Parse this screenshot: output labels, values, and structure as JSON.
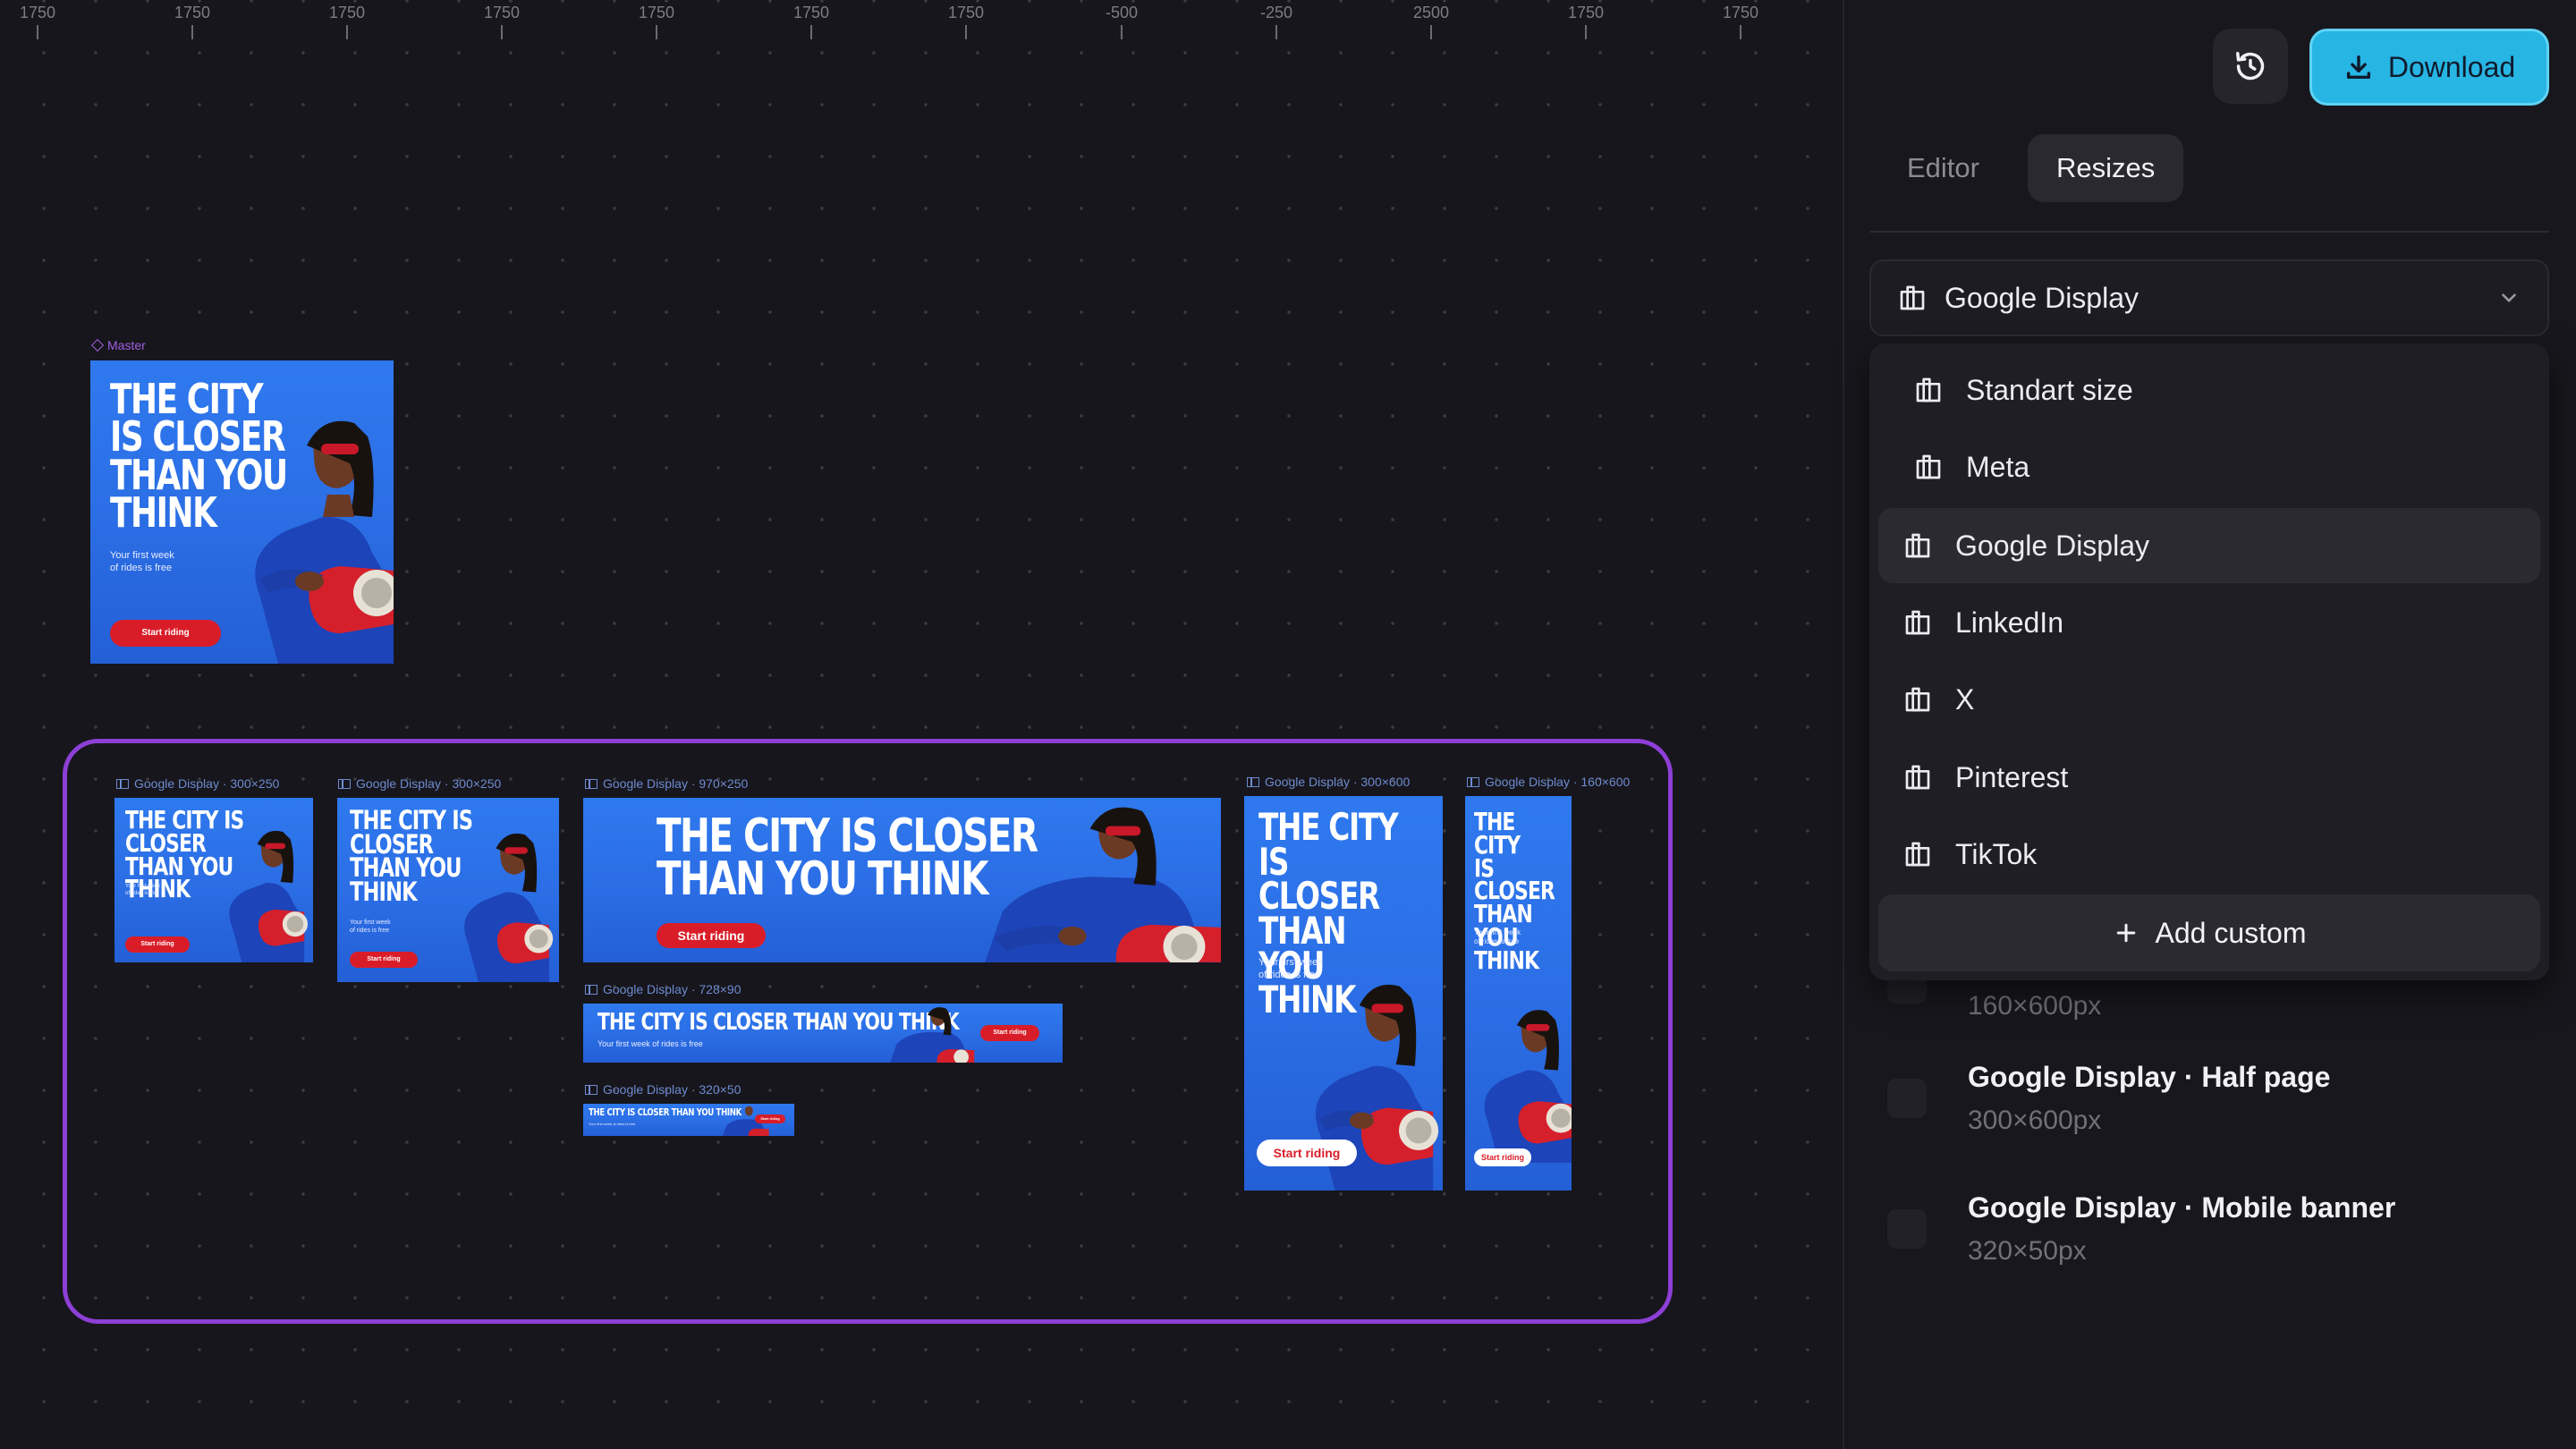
{
  "ruler": {
    "labels": [
      "1750",
      "1750",
      "1750",
      "1750",
      "1750",
      "1750",
      "1750",
      "-500",
      "-250",
      "2500",
      "1750",
      "1750"
    ]
  },
  "canvas": {
    "master": {
      "label": "Master",
      "ad": {
        "headline": "THE CITY\nIS CLOSER\nTHAN YOU\nTHINK",
        "sub": "Your first week\nof rides is free",
        "cta": "Start riding"
      }
    },
    "frames": [
      {
        "label": "Google Display · 300×250",
        "headline": "THE CITY IS CLOSER\nTHAN YOU\nTHINK",
        "sub": "Your first week\nof rides is free",
        "cta": "Start riding"
      },
      {
        "label": "Google Display · 300×250",
        "headline": "THE CITY IS\nCLOSER\nTHAN YOU\nTHINK",
        "sub": "Your first week\nof rides is free",
        "cta": "Start riding"
      },
      {
        "label": "Google Display · 970×250",
        "headline": "THE CITY IS CLOSER\nTHAN YOU THINK",
        "sub": "",
        "cta": "Start riding"
      },
      {
        "label": "Google Display · 728×90",
        "headline": "THE CITY IS CLOSER THAN YOU THINK",
        "sub": "Your first week of rides is free",
        "cta": "Start riding"
      },
      {
        "label": "Google Display · 320×50",
        "headline": "THE CITY IS CLOSER THAN YOU THINK",
        "sub": "Your first week of rides is free",
        "cta": "Start riding"
      },
      {
        "label": "Google Display · 300×600",
        "headline": "THE CITY IS\nCLOSER\nTHAN YOU\nTHINK",
        "sub": "Your first week\nof rides is free",
        "cta": "Start riding"
      },
      {
        "label": "Google Display · 160×600",
        "headline": "THE CITY\nIS CLOSER\nTHAN YOU\nTHINK",
        "sub": "Your first week\nof rides is free",
        "cta": "Start riding"
      }
    ]
  },
  "toolbar": {
    "history_icon": "history-icon",
    "download_label": "Download",
    "download_icon": "download-icon"
  },
  "tabs": [
    {
      "label": "Editor",
      "active": false
    },
    {
      "label": "Resizes",
      "active": true
    }
  ],
  "dropdown": {
    "selected": "Google Display",
    "icon": "layout-icon",
    "chevron": "chevron-down-icon"
  },
  "menu": {
    "items": [
      {
        "label": "Standart size",
        "active": false
      },
      {
        "label": "Meta",
        "active": false
      },
      {
        "label": "Google Display",
        "active": true
      },
      {
        "label": "LinkedIn",
        "active": false
      },
      {
        "label": "X",
        "active": false
      },
      {
        "label": "Pinterest",
        "active": false
      },
      {
        "label": "TikTok",
        "active": false
      }
    ],
    "add_custom": "Add custom"
  },
  "size_list": [
    {
      "title": "",
      "size": "160×600px"
    },
    {
      "title": "Google Display · Half page",
      "size": "300×600px"
    },
    {
      "title": "Google Display · Mobile banner",
      "size": "320×50px"
    }
  ],
  "colors": {
    "accent": "#27b5e3",
    "selection": "#8d3fd6",
    "ad_blue": "#2b6de4",
    "cta_red": "#d91d28"
  }
}
